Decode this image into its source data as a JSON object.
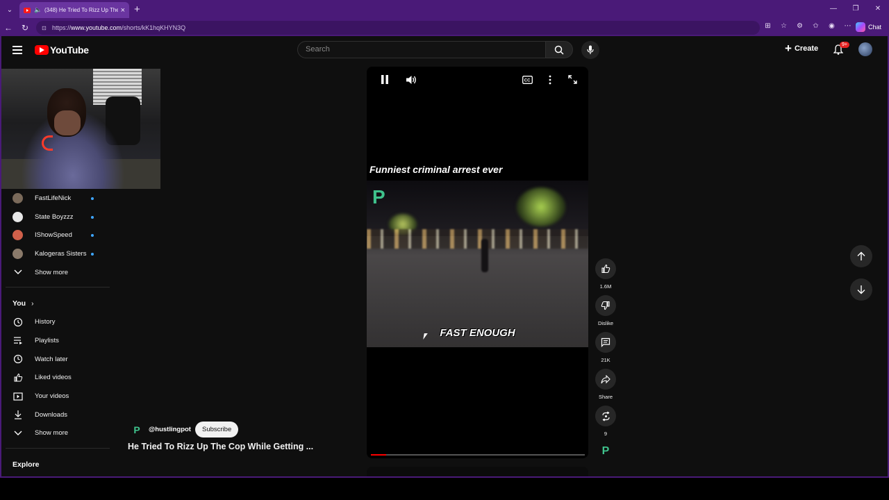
{
  "browser": {
    "tab_title": "(348) He Tried To Rizz Up The",
    "url_prefix": "https://",
    "url_host": "www.youtube.com",
    "url_path": "/shorts/kK1hqKHYN3Q",
    "copilot_label": "Chat"
  },
  "header": {
    "logo_text": "YouTube",
    "search_placeholder": "Search",
    "create_label": "Create",
    "notification_badge": "9+"
  },
  "sidebar": {
    "subscriptions": [
      {
        "label": "FastLifeNick",
        "color": "#7a6a5a"
      },
      {
        "label": "State Boyzzz",
        "color": "#e8e8e8"
      },
      {
        "label": "IShowSpeed",
        "color": "#d0604a"
      },
      {
        "label": "Kalogeras Sisters",
        "color": "#8a7a6a"
      }
    ],
    "show_more_1": "Show more",
    "you_heading": "You",
    "you_items": [
      {
        "label": "History",
        "icon": "history-icon"
      },
      {
        "label": "Playlists",
        "icon": "playlists-icon"
      },
      {
        "label": "Watch later",
        "icon": "watch-later-icon"
      },
      {
        "label": "Liked videos",
        "icon": "liked-videos-icon"
      },
      {
        "label": "Your videos",
        "icon": "your-videos-icon"
      },
      {
        "label": "Downloads",
        "icon": "downloads-icon"
      }
    ],
    "show_more_2": "Show more",
    "explore_heading": "Explore"
  },
  "video": {
    "top_caption": "Funniest criminal arrest ever",
    "subtitle": "FAST ENOUGH",
    "brand_mark": "P",
    "progress": 0.07
  },
  "actions": {
    "likes": "1.6M",
    "dislike_label": "Dislike",
    "comments": "21K",
    "share_label": "Share",
    "remix_count": "9"
  },
  "channel": {
    "handle": "@hustlingpot",
    "subscribe_label": "Subscribe",
    "short_title": "He Tried To Rizz Up The Cop While Getting ..."
  },
  "colors": {
    "browser_frame": "#4a1a78",
    "yt_red": "#ff0000",
    "brand_green": "#3fc28c",
    "background": "#0f0f0f"
  }
}
